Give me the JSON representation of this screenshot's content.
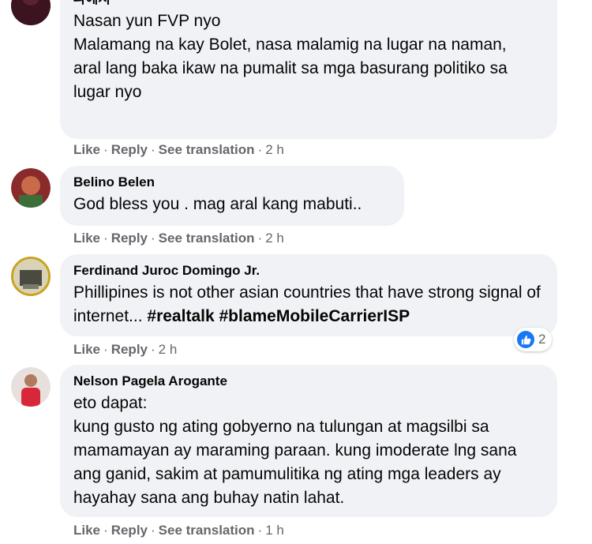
{
  "comments": [
    {
      "author": "파에지",
      "lines": [
        "Nasan yun FVP nyo",
        "Malamang na kay Bolet, nasa malamig na lugar na naman,",
        "aral lang baka ikaw na pumalit sa mga basurang politiko sa lugar nyo"
      ],
      "actions": {
        "like": "Like",
        "reply": "Reply",
        "translate": "See translation",
        "time": "2 h"
      }
    },
    {
      "author": "Belino Belen",
      "lines": [
        "God bless you . mag aral kang mabuti.."
      ],
      "actions": {
        "like": "Like",
        "reply": "Reply",
        "translate": "See translation",
        "time": "2 h"
      }
    },
    {
      "author": "Ferdinand Juroc Domingo Jr.",
      "text_plain": "Phillipines is not other asian countries that have strong signal of internet...",
      "hashtags": [
        "#realtalk",
        "#blameMobileCarrierISP"
      ],
      "reaction_count": "2",
      "actions": {
        "like": "Like",
        "reply": "Reply",
        "time": "2 h"
      }
    },
    {
      "author": "Nelson Pagela Arogante",
      "lines": [
        "eto dapat:",
        "kung gusto ng ating gobyerno na tulungan at magsilbi sa mamamayan ay maraming paraan. kung imoderate lng sana ang ganid, sakim at pamumulitika ng ating mga leaders ay hayahay sana ang buhay natin lahat."
      ],
      "actions": {
        "like": "Like",
        "reply": "Reply",
        "translate": "See translation",
        "time": "1 h"
      }
    }
  ],
  "colors": {
    "bubble": "#f0f2f5",
    "meta_text": "#65676b",
    "like_blue": "#1877f2"
  },
  "icons": {
    "reaction": "thumbs-up-icon"
  }
}
